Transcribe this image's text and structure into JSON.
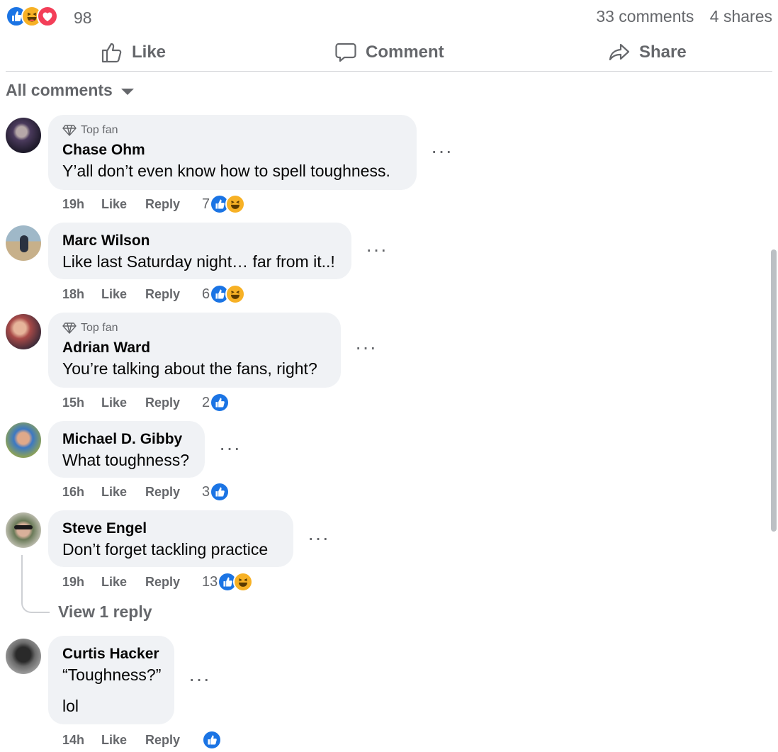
{
  "post_stats": {
    "reaction_icons": [
      "like-icon",
      "haha-icon",
      "love-icon"
    ],
    "reaction_count": "98",
    "comments": "33 comments",
    "shares": "4 shares"
  },
  "actions": {
    "like": "Like",
    "comment": "Comment",
    "share": "Share"
  },
  "filter": {
    "label": "All comments"
  },
  "comment_labels": {
    "like": "Like",
    "reply": "Reply",
    "top_fan": "Top fan"
  },
  "comments": [
    {
      "author": "Chase Ohm",
      "top_fan": true,
      "lines": [
        "Y’all don’t even know how to spell toughness."
      ],
      "time": "19h",
      "reaction_count": "7",
      "reactions": [
        "like-icon",
        "haha-icon"
      ]
    },
    {
      "author": "Marc Wilson",
      "top_fan": false,
      "lines": [
        "Like last Saturday night… far from it..!"
      ],
      "time": "18h",
      "reaction_count": "6",
      "reactions": [
        "like-icon",
        "haha-icon"
      ]
    },
    {
      "author": "Adrian Ward",
      "top_fan": true,
      "lines": [
        "You’re talking about the fans, right?"
      ],
      "time": "15h",
      "reaction_count": "2",
      "reactions": [
        "like-icon"
      ]
    },
    {
      "author": "Michael D. Gibby",
      "top_fan": false,
      "lines": [
        "What toughness?"
      ],
      "time": "16h",
      "reaction_count": "3",
      "reactions": [
        "like-icon"
      ]
    },
    {
      "author": "Steve Engel",
      "top_fan": false,
      "lines": [
        "Don’t forget tackling practice"
      ],
      "time": "19h",
      "reaction_count": "13",
      "reactions": [
        "like-icon",
        "haha-icon"
      ],
      "view_replies": "View 1 reply"
    },
    {
      "author": "Curtis Hacker",
      "top_fan": false,
      "lines": [
        "“Toughness?”",
        "lol"
      ],
      "time": "14h",
      "reaction_count": "",
      "reactions": [
        "like-icon"
      ]
    }
  ],
  "colors": {
    "like_blue": "#1b74e4",
    "haha_yellow": "#f7b125",
    "love_red": "#f33e58",
    "bubble_bg": "#f0f2f5",
    "secondary_text": "#65676b"
  }
}
